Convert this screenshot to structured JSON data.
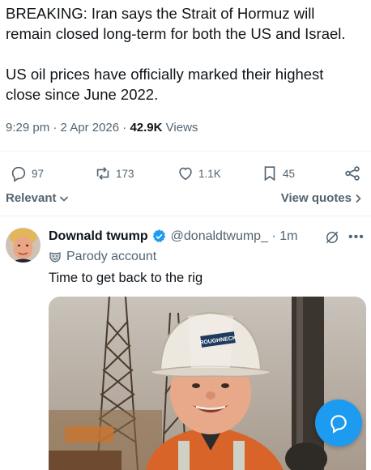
{
  "tweet": {
    "line1": "BREAKING: Iran says the Strait of Hormuz will remain closed long-term for both the US and Israel.",
    "line2": "US oil prices have officially marked their highest close since June 2022.",
    "time": "9:29 pm",
    "date": "2 Apr 2026",
    "views_count": "42.9K",
    "views_label": "Views"
  },
  "actions": {
    "replies": "97",
    "reposts": "173",
    "likes": "1.1K",
    "bookmarks": "45"
  },
  "filters": {
    "relevant": "Relevant",
    "view_quotes": "View quotes"
  },
  "reply": {
    "name": "Downald twump",
    "handle": "@donaldtwump_",
    "time": "1m",
    "label": "Parody account",
    "text": "Time to get back to the rig",
    "helmet_text": "ROUGHNECK"
  },
  "colors": {
    "accent": "#1d9bf0",
    "secondary_text": "#536471",
    "primary_text": "#0f1419"
  }
}
